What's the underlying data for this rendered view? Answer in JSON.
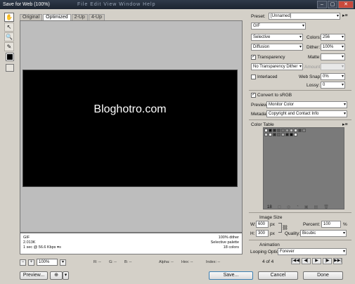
{
  "window": {
    "title": "Save for Web (100%)",
    "menu_ghost": "File Edit View Window Help",
    "controls": [
      "–",
      "▢",
      "✕"
    ]
  },
  "tools": [
    {
      "name": "hand-tool",
      "glyph": "✋"
    },
    {
      "name": "slice-select-tool",
      "glyph": "↖"
    },
    {
      "name": "zoom-tool",
      "glyph": "🔍"
    },
    {
      "name": "eyedropper-tool",
      "glyph": "✎"
    }
  ],
  "tabs": [
    "Original",
    "Optimized",
    "2-Up",
    "4-Up"
  ],
  "active_tab": "Optimized",
  "preview": {
    "image_text": "Bloghotro.com",
    "info_left": [
      "GIF",
      "2.013K",
      "1 sec @ 56.6 Kbps"
    ],
    "info_left_menu": "▾≡",
    "info_right": [
      "100% dither",
      "Selective palette",
      "18 colors"
    ]
  },
  "status": {
    "zoom": "100%",
    "r": "R: --",
    "g": "G: --",
    "b": "B: --",
    "alpha": "Alpha: --",
    "hex": "Hex: --",
    "index": "Index: --"
  },
  "buttons": {
    "preview": "Preview...",
    "save": "Save...",
    "cancel": "Cancel",
    "done": "Done"
  },
  "settings": {
    "preset_label": "Preset:",
    "preset_value": "[Unnamed]",
    "format": "GIF",
    "reduction": "Selective",
    "colors_label": "Colors:",
    "colors": "256",
    "dither_algo": "Diffusion",
    "dither_label": "Dither:",
    "dither": "100%",
    "transparency_label": "Transparency",
    "transparency_checked": true,
    "matte_label": "Matte:",
    "matte": "",
    "transparency_dither": "No Transparency Dither",
    "amount_label": "Amount:",
    "amount": "",
    "interlaced_label": "Interlaced",
    "interlaced_checked": false,
    "websnap_label": "Web Snap:",
    "websnap": "0%",
    "lossy_label": "Lossy:",
    "lossy": "0",
    "convert_srgb_label": "Convert to sRGB",
    "convert_srgb_checked": true,
    "preview_label": "Preview:",
    "preview_value": "Monitor Color",
    "metadata_label": "Metadata:",
    "metadata_value": "Copyright and Contact Info"
  },
  "color_table": {
    "title": "Color Table",
    "count": "18",
    "swatches": [
      "#ffffff",
      "#111111",
      "#2b2b2b",
      "#555555",
      "#777777",
      "#999999",
      "#bbbbbb",
      "#dddddd",
      "#444444",
      "#888888",
      "#cccccc",
      "#eeeeee",
      "#333333",
      "#666666",
      "#aaaaaa",
      "#222222",
      "#000000",
      "#f5f5f5"
    ],
    "tool_icons": [
      "◻",
      "◎",
      "◔",
      "▣",
      "▤",
      "🗑"
    ]
  },
  "image_size": {
    "title": "Image Size",
    "w_label": "W:",
    "w": "600",
    "h_label": "H:",
    "h": "300",
    "unit": "px",
    "percent_label": "Percent:",
    "percent": "100",
    "percent_unit": "%",
    "quality_label": "Quality:",
    "quality": "Bicubic"
  },
  "animation": {
    "title": "Animation",
    "looping_label": "Looping Options:",
    "looping": "Forever",
    "frame": "4 of 4",
    "controls": [
      "|◀◀",
      "◀|",
      "▶",
      "|▶",
      "▶▶|"
    ]
  },
  "panel_menu_icon": "▸≡"
}
